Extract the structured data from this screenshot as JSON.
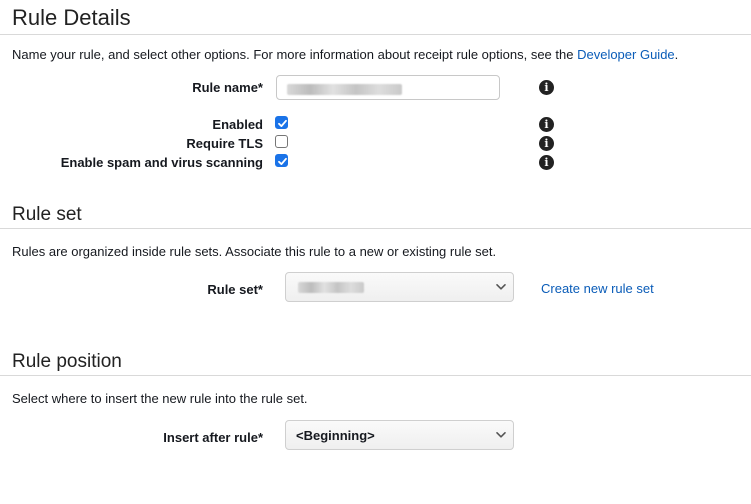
{
  "rule_details": {
    "title": "Rule Details",
    "description": "Name your rule, and select other options. For more information about receipt rule options, see the",
    "developer_guide_link": "Developer Guide",
    "description_suffix": ".",
    "rule_name_label": "Rule name*",
    "rule_name_value": "",
    "enabled_label": "Enabled",
    "enabled_checked": true,
    "require_tls_label": "Require TLS",
    "require_tls_checked": false,
    "spam_scan_label": "Enable spam and virus scanning",
    "spam_scan_checked": true,
    "info_glyph": "i"
  },
  "rule_set": {
    "title": "Rule set",
    "description": "Rules are organized inside rule sets. Associate this rule to a new or existing rule set.",
    "label": "Rule set*",
    "selected_value": "",
    "create_link": "Create new rule set"
  },
  "rule_position": {
    "title": "Rule position",
    "description": "Select where to insert the new rule into the rule set.",
    "label": "Insert after rule*",
    "selected_value": "<Beginning>"
  },
  "colors": {
    "link": "#0a5cb8",
    "checkbox": "#1a73e8",
    "text": "#16191f",
    "divider": "#d9d9d9"
  }
}
